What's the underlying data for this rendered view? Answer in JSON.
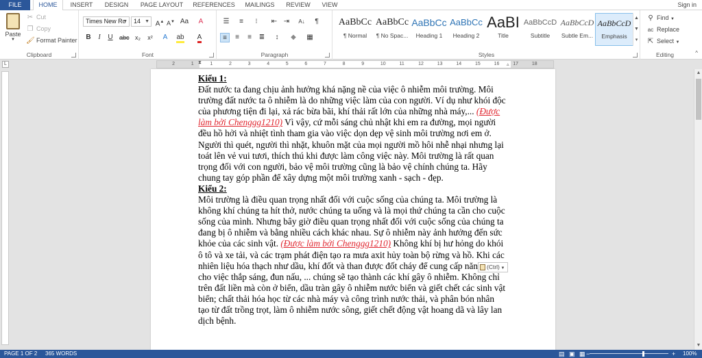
{
  "tabs": [
    "FILE",
    "HOME",
    "INSERT",
    "DESIGN",
    "PAGE LAYOUT",
    "REFERENCES",
    "MAILINGS",
    "REVIEW",
    "VIEW"
  ],
  "sign_in": "Sign in",
  "clipboard": {
    "label": "Clipboard",
    "paste": "Paste",
    "cut": "Cut",
    "copy": "Copy",
    "format_painter": "Format Painter"
  },
  "font": {
    "label": "Font",
    "family": "Times New Ro",
    "size": "14"
  },
  "paragraph": {
    "label": "Paragraph"
  },
  "styles": {
    "label": "Styles",
    "items": [
      {
        "preview": "AaBbCc",
        "name": "¶ Normal"
      },
      {
        "preview": "AaBbCc",
        "name": "¶ No Spac..."
      },
      {
        "preview": "AaBbCc",
        "name": "Heading 1"
      },
      {
        "preview": "AaBbCc",
        "name": "Heading 2"
      },
      {
        "preview": "AaBI",
        "name": "Title"
      },
      {
        "preview": "AaBbCcD",
        "name": "Subtitle"
      },
      {
        "preview": "AaBbCcD",
        "name": "Subtle Em..."
      },
      {
        "preview": "AaBbCcD",
        "name": "Emphasis"
      }
    ]
  },
  "editing": {
    "label": "Editing",
    "find": "Find",
    "replace": "Replace",
    "select": "Select"
  },
  "ruler": {
    "numbers": [
      "2",
      "1",
      "1",
      "2",
      "3",
      "4",
      "5",
      "6",
      "7",
      "8",
      "9",
      "10",
      "11",
      "12",
      "13",
      "14",
      "15",
      "16",
      "17",
      "18"
    ]
  },
  "document": {
    "heading1": "Kiểu 1:",
    "p1_a": "Đất nước ta đang chịu ảnh hưởng khá nặng nề của việc ô nhiễm môi trường. Môi trường đất nước ta ô nhiễm là do những việc làm của con người. Ví dụ như khói độc của phương tiện đi lại, xả rác bừa bãi, khí thải rất lớn của những nhà máy,... ",
    "credit1": "(Được làm bởi Chenggg1210)",
    "p1_b": " Vì vậy, cứ mỗi sáng chủ nhật khi em ra đường, mọi người đều hồ hởi và nhiệt tình tham gia vào việc dọn dẹp vệ sinh môi trường nơi em ở. Người thì quét, người thì nhặt, khuôn mặt của mọi người mồ hôi nhễ nhại nhưng lại toát lên vẻ vui tươi, thích thú khi được làm công việc này. Môi trường là rất quan trọng đối với con người, bảo vệ môi trường cũng là bảo vệ chính chúng ta. Hãy chung tay góp phần để xây dựng một môi trường xanh - sạch - đẹp.",
    "heading2": "Kiểu 2:",
    "p2_a": "Môi trường là điều quan trọng nhất đối với cuộc sống của chúng ta. Môi trường là không khí chúng ta hít thở, nước chúng ta uống và là mọi thứ chúng ta cần cho cuộc sống của mình. Nhưng bây giờ điều quan trọng nhất đối với cuộc sống của chúng ta đang bị ô nhiễm và bằng nhiều cách khác nhau. Sự ô nhiễm này ảnh hưởng đến sức khỏe của các sinh vật. ",
    "credit2": "(Được làm bởi Chenggg1210)",
    "p2_b": " Không khí bị hư hỏng do khói ô tô và xe tải, và các trạm phát điện tạo ra mưa axit hủy toàn bộ rừng và hồ. Khi các nhiên liệu hóa thạch như dầu, khí đốt và than được đốt cháy để cung cấp năng lượng cho việc thắp sáng, đun nấu, ... chúng sẽ tạo thành các khí gây ô nhiễm. Không chỉ trên đất liền mà còn ở biển, dầu tràn gây ô nhiễm nước biển và giết chết các sinh vật biển; chất thải hóa học từ các nhà máy và công trình nước thải, và phân bón nhân tạo từ đất trồng trọt, làm ô nhiễm nước sông, giết chết động vật hoang dã và lây lan dịch bệnh.",
    "paste_options": "(Ctrl)"
  },
  "status": {
    "page": "PAGE 1 OF 2",
    "words": "365 WORDS",
    "zoom": "100%",
    "zoom_percent": 100
  },
  "colors": {
    "accent": "#2b579a",
    "credit": "#e0242d"
  }
}
